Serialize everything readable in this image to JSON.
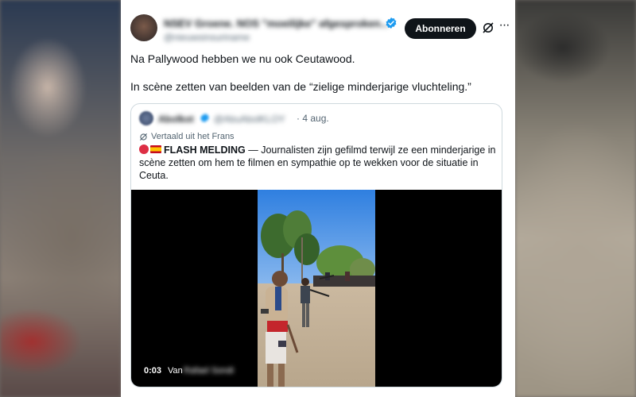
{
  "post": {
    "author_name": "NSEV Groene. NOS \"moeilijke\" afgesproken...",
    "author_handle": "@nieuwsinsuriname",
    "subscribe_label": "Abonneren",
    "more_label": "···",
    "text_line1": "Na Pallywood hebben we nu ook Ceutawood.",
    "text_line2": "In scène zetten van beelden van de “zielige minderjarige vluchteling.”"
  },
  "quote": {
    "author_name": "Abolkot",
    "author_handle": "@AbuAbolKLOY",
    "separator": "·",
    "date": "4 aug.",
    "translated_label": "Vertaald uit het Frans",
    "flash_label": "FLASH MELDING",
    "body": " — Journalisten zijn gefilmd terwijl ze een minderjarige in scène zetten om hem te filmen en sympathie op te wekken voor de situatie in Ceuta."
  },
  "video": {
    "timestamp": "0:03",
    "attribution_prefix": "Van",
    "attribution_name": "Rafael Sondi"
  },
  "colors": {
    "text": "#0f1419",
    "muted": "#536471",
    "verified": "#1d9bf0",
    "border": "#cfd9de",
    "button_bg": "#0f1419"
  }
}
